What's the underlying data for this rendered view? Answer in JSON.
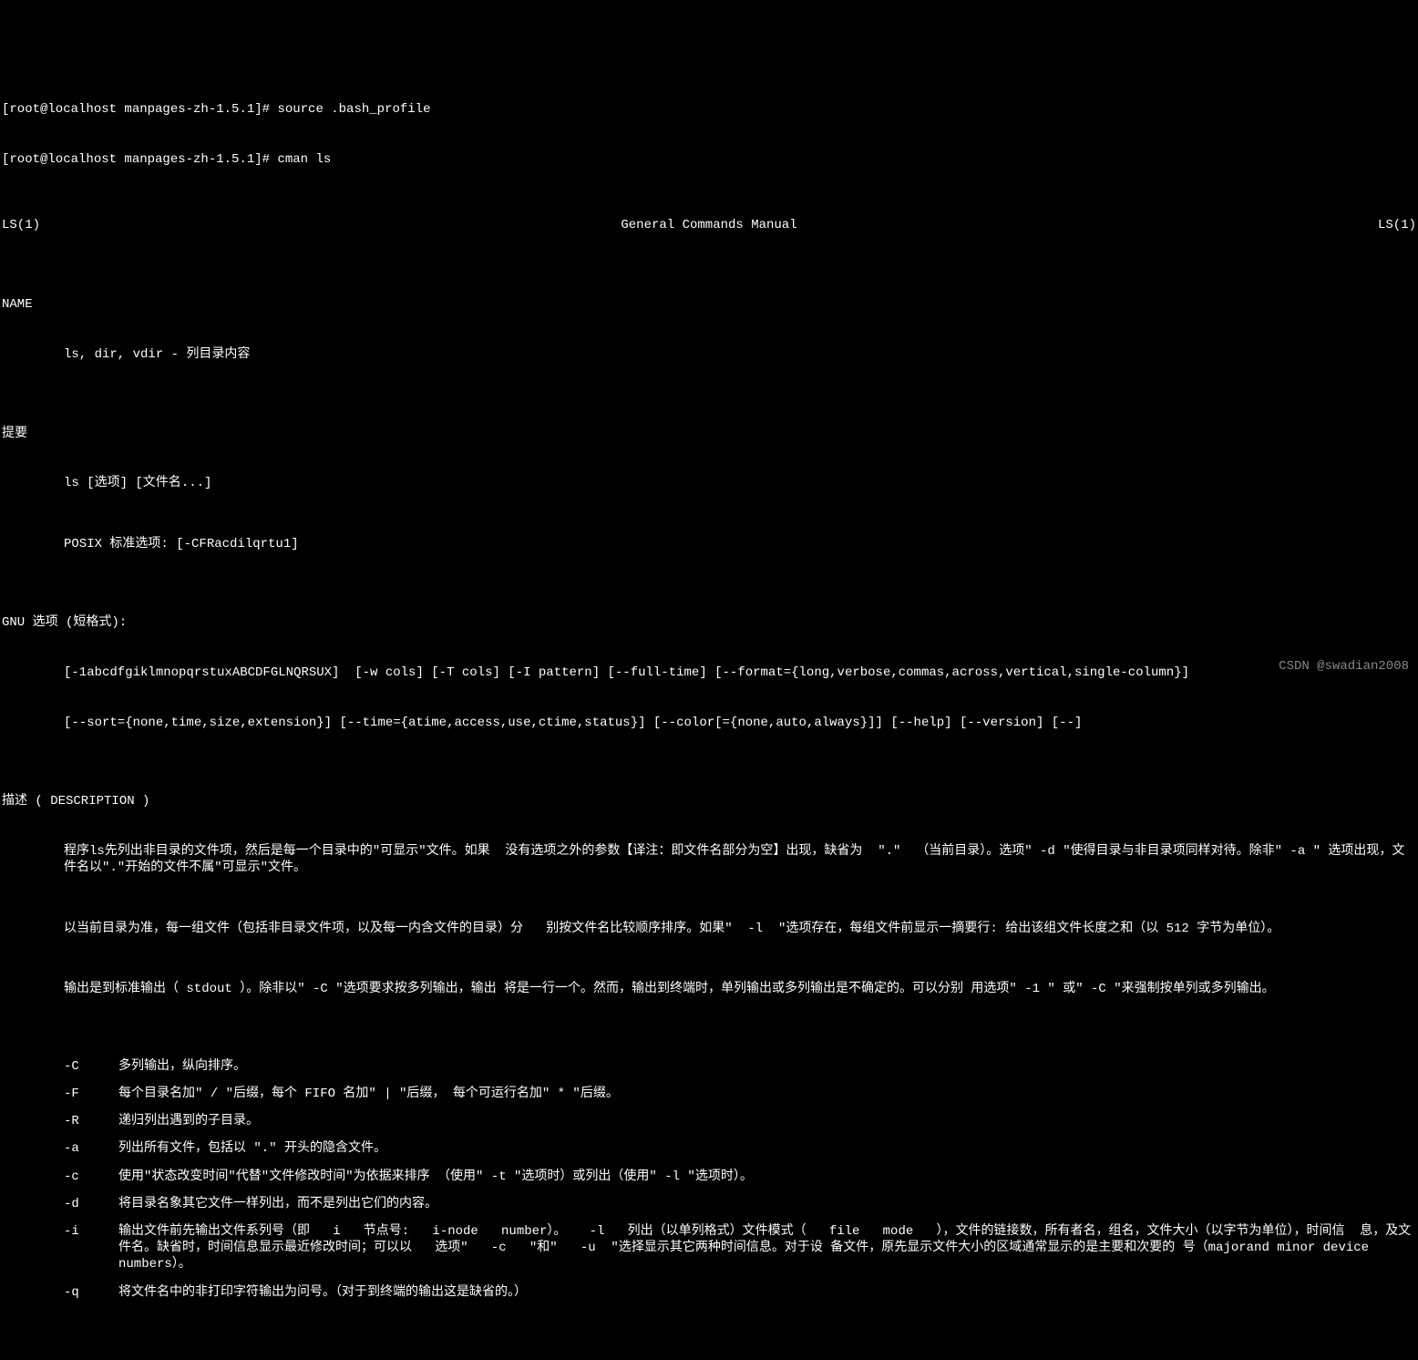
{
  "prompt1": "[root@localhost manpages-zh-1.5.1]# source .bash_profile",
  "prompt2": "[root@localhost manpages-zh-1.5.1]# cman ls",
  "header": {
    "left": "LS(1)",
    "center": "General Commands Manual",
    "right": "LS(1)"
  },
  "sections": {
    "name": {
      "heading": "NAME",
      "content": "ls, dir, vdir - 列目录内容"
    },
    "synopsis": {
      "heading": "提要",
      "line1": "ls [选项] [文件名...]",
      "line2": "POSIX 标准选项: [-CFRacdilqrtu1]"
    },
    "gnu": {
      "heading": "GNU 选项 (短格式):",
      "line1": "[-1abcdfgiklmnopqrstuxABCDFGLNQRSUX]  [-w cols] [-T cols] [-I pattern] [--full-time] [--format={long,verbose,commas,across,vertical,single-column}]",
      "line2": "[--sort={none,time,size,extension}] [--time={atime,access,use,ctime,status}] [--color[={none,auto,always}]] [--help] [--version] [--]"
    },
    "description": {
      "heading": "描述 ( DESCRIPTION )",
      "para1": "程序ls先列出非目录的文件项，然后是每一个目录中的\"可显示\"文件。如果  没有选项之外的参数【译注：即文件名部分为空】出现，缺省为  \".\"  （当前目录）。选项\" -d \"使得目录与非目录项同样对待。除非\" -a \" 选项出现，文 件名以\".\"开始的文件不属\"可显示\"文件。",
      "para2": "以当前目录为准，每一组文件（包括非目录文件项，以及每一内含文件的目录）分   别按文件名比较顺序排序。如果\"  -l  \"选项存在，每组文件前显示一摘要行: 给出该组文件长度之和（以 512 字节为单位）。",
      "para3": "输出是到标准输出（ stdout ）。除非以\" -C \"选项要求按多列输出，输出 将是一行一个。然而，输出到终端时，单列输出或多列输出是不确定的。可以分别 用选项\" -1 \" 或\" -C \"来强制按单列或多列输出。",
      "options": [
        {
          "flag": "-C",
          "desc": "多列输出，纵向排序。"
        },
        {
          "flag": "-F",
          "desc": "每个目录名加\" / \"后缀，每个 FIFO 名加\" | \"后缀， 每个可运行名加\" * \"后缀。"
        },
        {
          "flag": "-R",
          "desc": "递归列出遇到的子目录。"
        },
        {
          "flag": "-a",
          "desc": "列出所有文件，包括以 \".\" 开头的隐含文件。"
        },
        {
          "flag": "-c",
          "desc": "使用\"状态改变时间\"代替\"文件修改时间\"为依据来排序 （使用\" -t \"选项时）或列出（使用\" -l \"选项时）。"
        },
        {
          "flag": "-d",
          "desc": "将目录名象其它文件一样列出，而不是列出它们的内容。"
        },
        {
          "flag": "-i",
          "desc": "输出文件前先输出文件系列号（即   i   节点号:   i-node   number）。   -l   列出（以单列格式）文件模式（   file   mode   ），文件的链接数，所有者名，组名，文件大小（以字节为单位），时间信  息，及文件名。缺省时，时间信息显示最近修改时间；可以以   选项\"   -c   \"和\"   -u  \"选择显示其它两种时间信息。对于设 备文件，原先显示文件大小的区域通常显示的是主要和次要的 号（majorand minor device numbers）。"
        },
        {
          "flag": "-q",
          "desc": "将文件名中的非打印字符输出为问号。（对于到终端的输出这是缺省的。）"
        }
      ]
    }
  },
  "watermark": "CSDN @swadian2008"
}
